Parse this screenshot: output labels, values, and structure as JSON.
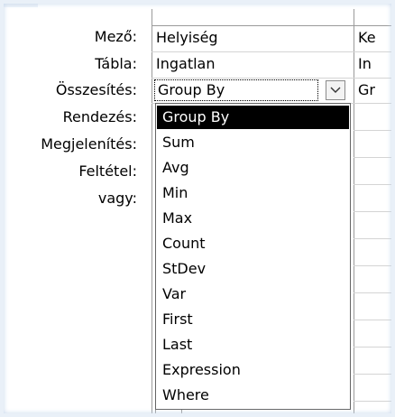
{
  "labels": {
    "mezo": "Mező:",
    "tabla": "Tábla:",
    "osszesites": "Összesítés:",
    "rendezes": "Rendezés:",
    "megjelenites": "Megjelenítés:",
    "feltetel": "Feltétel:",
    "vagy": "vagy:"
  },
  "column1": {
    "field": "Helyiség",
    "table": "Ingatlan",
    "total": "Group By"
  },
  "column2": {
    "field": "Ke",
    "table": "In",
    "total": "Gr"
  },
  "dropdown": {
    "items": [
      "Group By",
      "Sum",
      "Avg",
      "Min",
      "Max",
      "Count",
      "StDev",
      "Var",
      "First",
      "Last",
      "Expression",
      "Where"
    ],
    "selected_index": 0
  },
  "icons": {
    "combo_arrow": "chevron-down-icon"
  },
  "colors": {
    "selection": "#000000",
    "frame": "#e9f0f8"
  }
}
